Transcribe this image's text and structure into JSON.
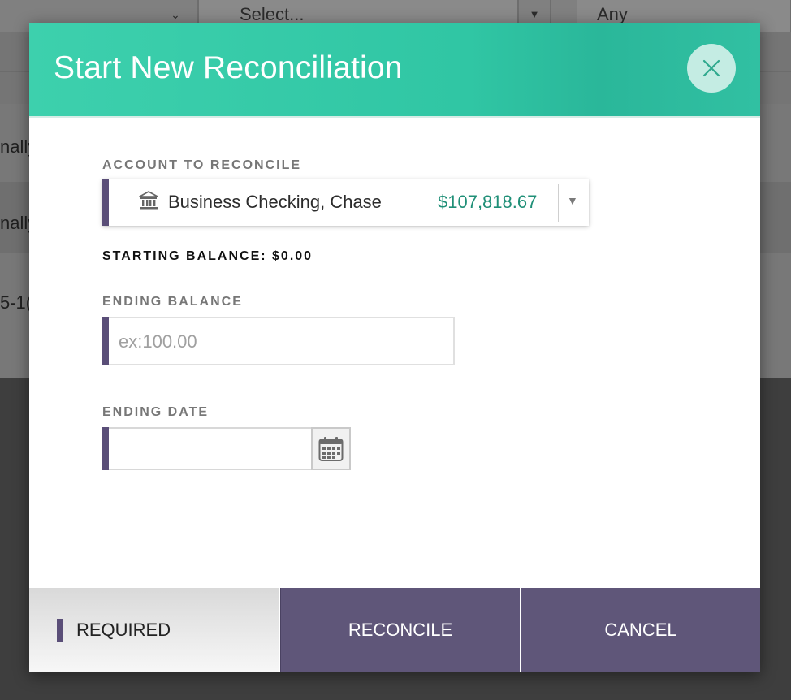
{
  "background": {
    "select_placeholder": "Select...",
    "any_filter": "Any",
    "row_texts": [
      "nally",
      "nally",
      "5-1("
    ]
  },
  "modal": {
    "title": "Start New Reconciliation",
    "account": {
      "label": "ACCOUNT TO RECONCILE",
      "name": "Business Checking, Chase",
      "balance": "$107,818.67"
    },
    "starting_balance": "STARTING BALANCE: $0.00",
    "ending_balance": {
      "label": "ENDING BALANCE",
      "placeholder": "ex:100.00",
      "value": ""
    },
    "ending_date": {
      "label": "ENDING DATE",
      "value": ""
    },
    "footer": {
      "required_legend": "REQUIRED",
      "reconcile_label": "RECONCILE",
      "cancel_label": "CANCEL"
    }
  },
  "colors": {
    "header_teal": "#31c6a4",
    "required_purple": "#5a4e78",
    "button_purple": "#5f5679",
    "amount_green": "#1f8f77"
  },
  "icons": [
    "close-icon",
    "bank-icon",
    "dropdown-arrow-icon",
    "calendar-icon",
    "chevron-down-icon"
  ]
}
